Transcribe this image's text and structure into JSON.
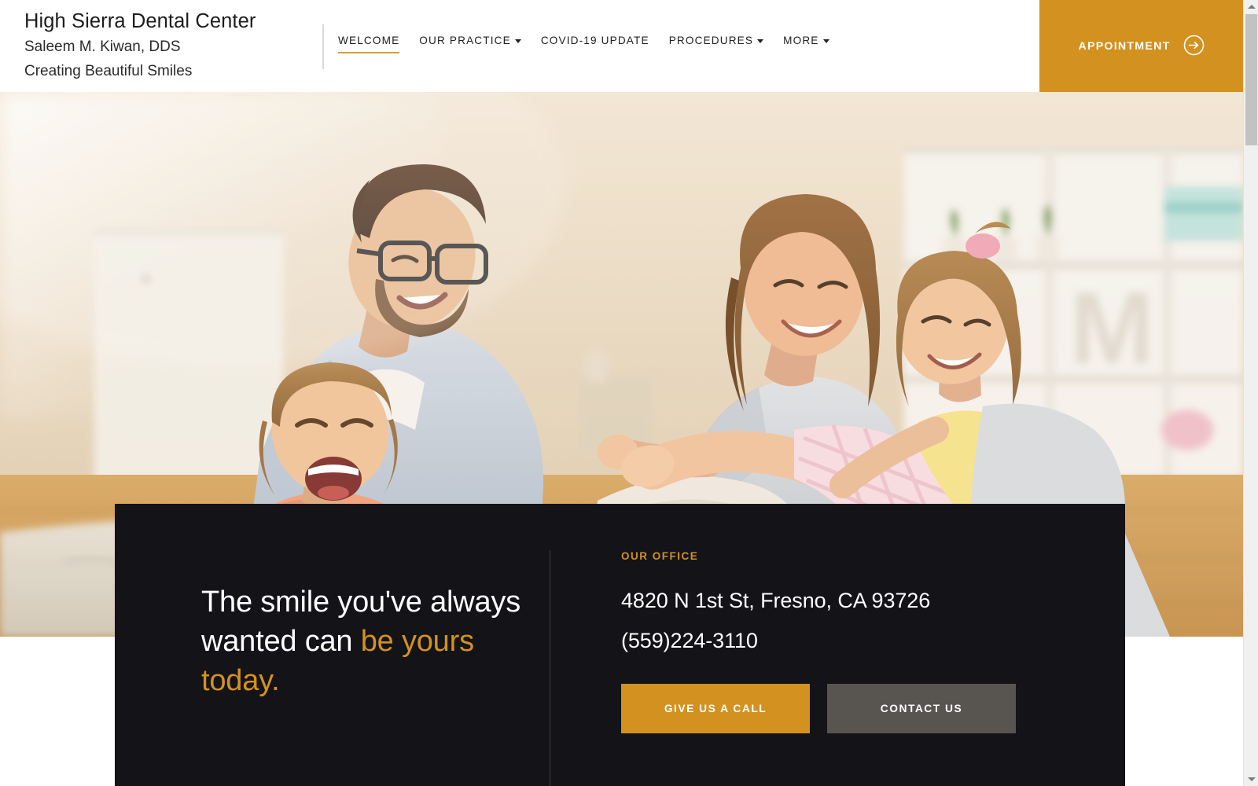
{
  "header": {
    "brand": {
      "name": "High Sierra Dental Center",
      "doctor": "Saleem M. Kiwan, DDS",
      "tagline": "Creating Beautiful Smiles"
    },
    "nav": [
      {
        "label": "WELCOME",
        "has_caret": false,
        "active": true
      },
      {
        "label": "OUR PRACTICE",
        "has_caret": true,
        "active": false
      },
      {
        "label": "COVID-19 UPDATE",
        "has_caret": false,
        "active": false
      },
      {
        "label": "PROCEDURES",
        "has_caret": true,
        "active": false
      },
      {
        "label": "MORE",
        "has_caret": true,
        "active": false
      }
    ],
    "appointment_label": "APPOINTMENT",
    "appointment_icon": "arrow-right-circle-icon"
  },
  "hero": {
    "alt": "Family with two young daughters playing and laughing together on a living room rug"
  },
  "callout": {
    "headline_plain": "The smile you've always wanted can ",
    "headline_accent": "be yours today.",
    "office_label": "OUR OFFICE",
    "address": "4820 N 1st St, Fresno, CA 93726",
    "phone": "(559)224-3110",
    "call_button_label": "GIVE US A CALL",
    "contact_button_label": "CONTACT US"
  },
  "colors": {
    "accent_gold": "#d3911f",
    "panel_dark": "#131318",
    "contact_gray": "#58544f",
    "nav_underline": "#cfa13c"
  },
  "scrollbar": {
    "up_icon": "scroll-up-arrow-icon",
    "down_icon": "scroll-down-arrow-icon"
  }
}
